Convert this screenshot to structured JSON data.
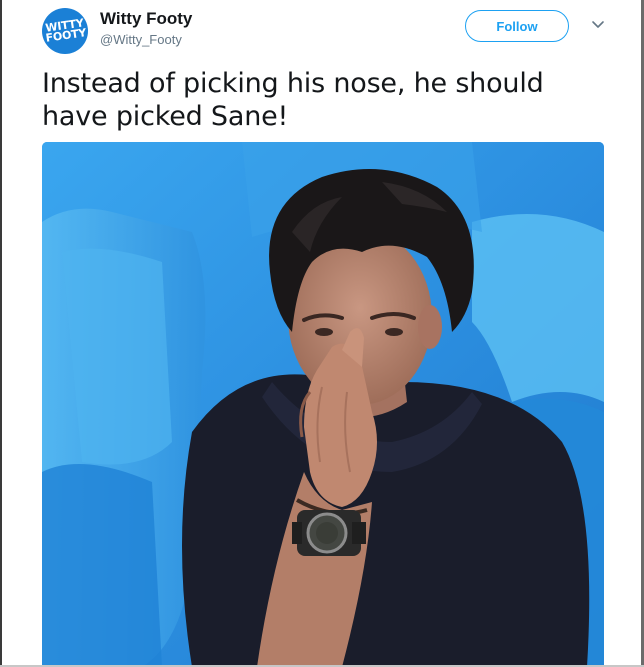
{
  "tweet": {
    "author": {
      "display_name": "Witty Footy",
      "handle": "@Witty_Footy",
      "avatar_text": [
        "WITTY",
        "FOOTY"
      ]
    },
    "follow_label": "Follow",
    "text": "Instead of picking his nose, he should have picked Sane!",
    "media": {
      "kind": "photo",
      "subject": "man-touching-nose"
    }
  },
  "colors": {
    "accent": "#1da1f2",
    "avatar_bg": "#1b80d6",
    "handle_gray": "#657786",
    "text": "#14171a"
  },
  "icons": {
    "menu_caret": "chevron-down-icon"
  }
}
